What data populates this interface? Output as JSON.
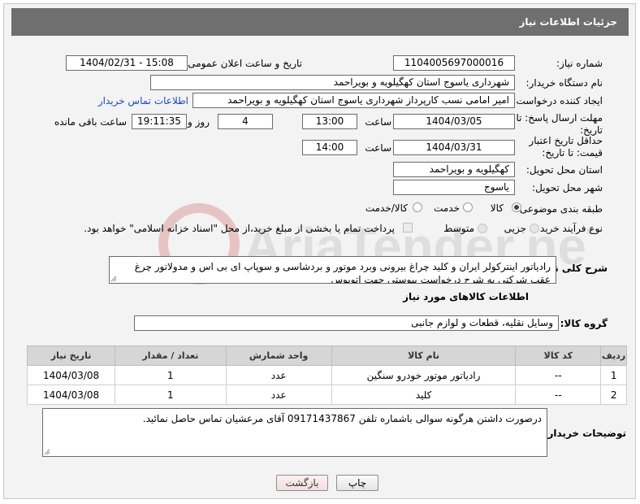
{
  "header": {
    "title": "جزئیات اطلاعات نیاز"
  },
  "fields": {
    "need_number_label": "شماره نیاز:",
    "need_number": "1104005697000016",
    "announce_label": "تاریخ و ساعت اعلان عمومی:",
    "announce_value": "1404/02/31 - 15:08",
    "buyer_org_label": "نام دستگاه خریدار:",
    "buyer_org": "شهرداری یاسوج استان کهگیلویه و بویراحمد",
    "creator_label": "ایجاد کننده درخواست:",
    "creator": "امیر امامی نسب کارپرداز شهرداری یاسوج استان کهگیلویه و بویراحمد",
    "contact_link": "اطلاعات تماس خریدار",
    "reply_deadline_label": "مهلت ارسال پاسخ: تا تاریخ:",
    "reply_date": "1404/03/05",
    "time_label": "ساعت",
    "reply_time": "13:00",
    "days_value": "4",
    "days_label": "روز و",
    "remaining_time": "19:11:35",
    "remaining_label": "ساعت باقی مانده",
    "price_validity_label": "حداقل تاریخ اعتبار قیمت: تا تاریخ:",
    "price_date": "1404/03/31",
    "price_time": "14:00",
    "province_label": "استان محل تحویل:",
    "province": "کهگیلویه و بویراحمد",
    "city_label": "شهر محل تحویل:",
    "city": "یاسوج",
    "category_label": "طبقه بندی موضوعی:",
    "category_options": [
      "کالا",
      "خدمت",
      "کالا/خدمت"
    ],
    "process_label": "نوع فرآیند خرید :",
    "process_options": [
      "جزیی",
      "متوسط"
    ],
    "payment_note": "پرداخت تمام یا بخشی از مبلغ خرید،از محل \"اسناد خزانه اسلامی\" خواهد بود.",
    "description_label": "شرح کلی نیاز:",
    "description": "رادیاتور اینترکولر ایران و کلید چراغ بیرونی وبرد موتور و بردشاسی و سوپاپ ای بی اس و مدولاتور چرغ عقب شرکتی به شرح درخواست پیوستی جهت اتوبوس",
    "goods_info_title": "اطلاعات کالاهای مورد نیاز",
    "goods_group_label": "گروه کالا:",
    "goods_group": "وسایل نقلیه، قطعات و لوازم جانبی",
    "buyer_notes_label": "توضیحات خریدار:",
    "buyer_notes": "درصورت داشتن هرگونه سوالی باشماره تلفن 09171437867 آقای مرعشیان تماس حاصل نمائید."
  },
  "table": {
    "headers": [
      "ردیف",
      "کد کالا",
      "نام کالا",
      "واحد شمارش",
      "تعداد / مقدار",
      "تاریخ نیاز"
    ],
    "rows": [
      [
        "1",
        "--",
        "رادیاتور موتور خودرو سنگین",
        "عدد",
        "1",
        "1404/03/08"
      ],
      [
        "2",
        "--",
        "کلید",
        "عدد",
        "1",
        "1404/03/08"
      ]
    ]
  },
  "buttons": {
    "print": "چاپ",
    "back": "بازگشت"
  },
  "watermark": {
    "text": "AriaTender.neT"
  }
}
